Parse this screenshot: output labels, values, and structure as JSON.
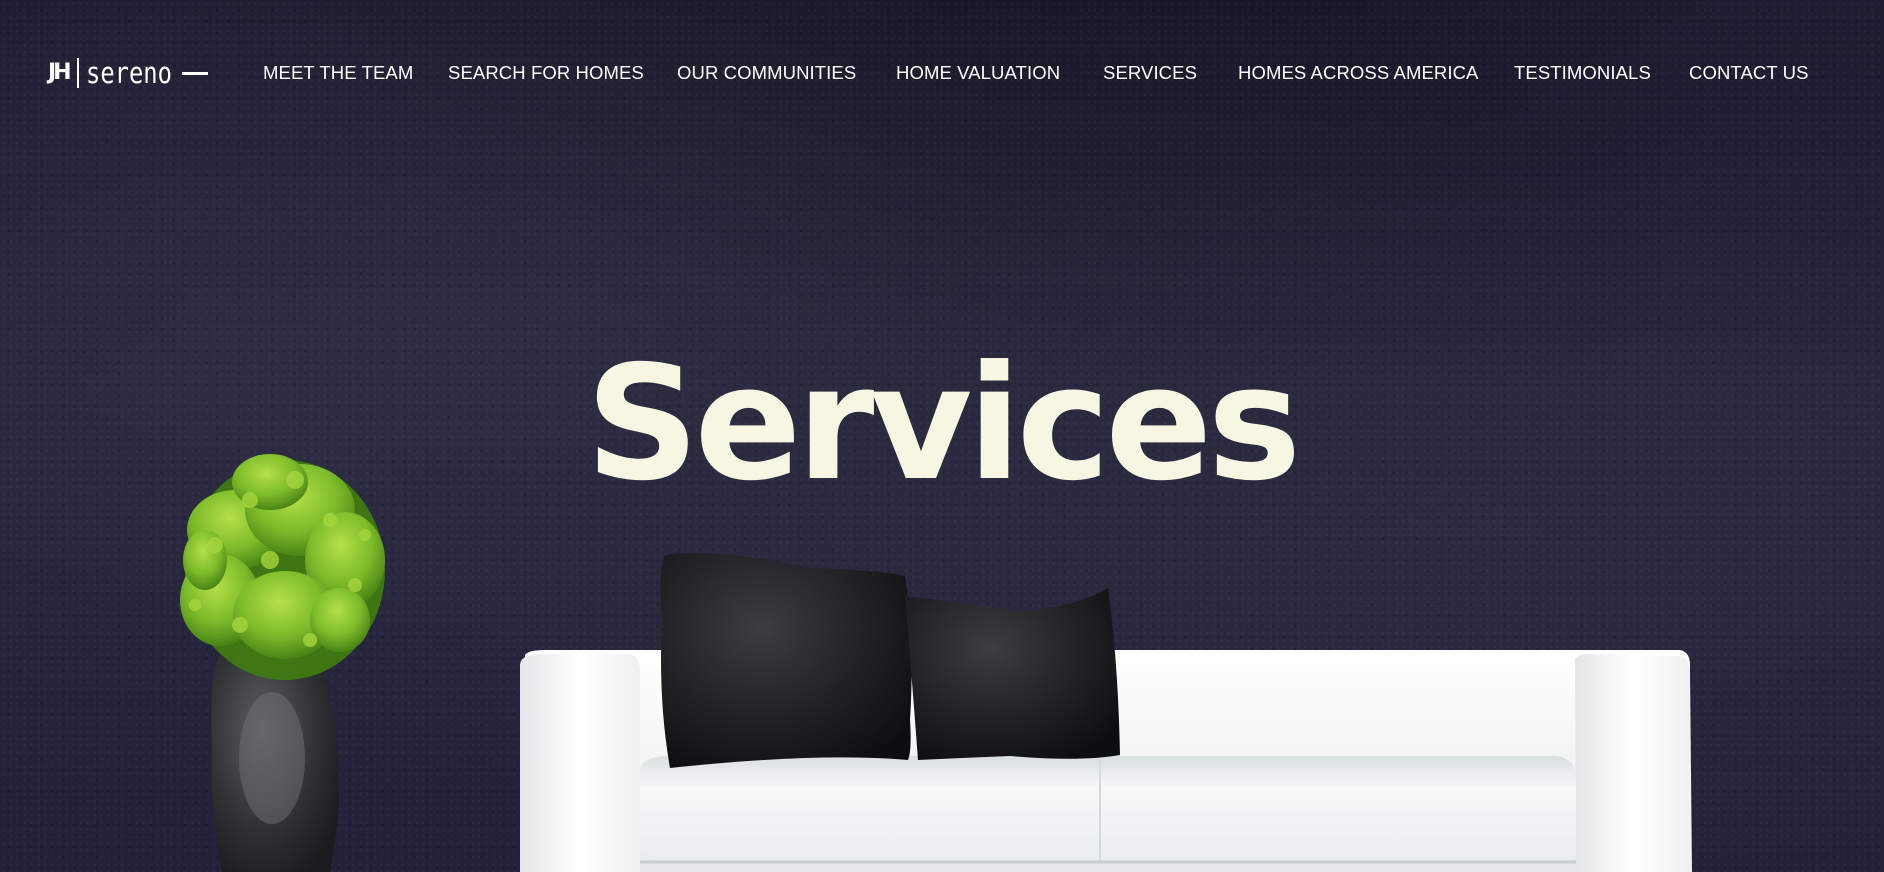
{
  "header": {
    "logo": {
      "mark": "JH",
      "word": "sereno"
    },
    "nav": [
      {
        "label": "MEET THE TEAM",
        "id": "meet-the-team"
      },
      {
        "label": "SEARCH FOR HOMES",
        "id": "search-for-homes"
      },
      {
        "label": "OUR COMMUNITIES",
        "id": "our-communities"
      },
      {
        "label": "HOME VALUATION",
        "id": "home-valuation"
      },
      {
        "label": "SERVICES",
        "id": "services"
      },
      {
        "label": "HOMES ACROSS AMERICA",
        "id": "homes-across-america"
      },
      {
        "label": "TESTIMONIALS",
        "id": "testimonials"
      },
      {
        "label": "CONTACT US",
        "id": "contact-us"
      }
    ]
  },
  "hero": {
    "title": "Services"
  },
  "colors": {
    "background": "#22213a",
    "title": "#f7f6e3",
    "nav_text": "#ffffff",
    "sofa": "#f4f6f6",
    "pillow": "#1a1b1d",
    "plant": "#7fbf2e",
    "vase": "#2d2f32"
  }
}
